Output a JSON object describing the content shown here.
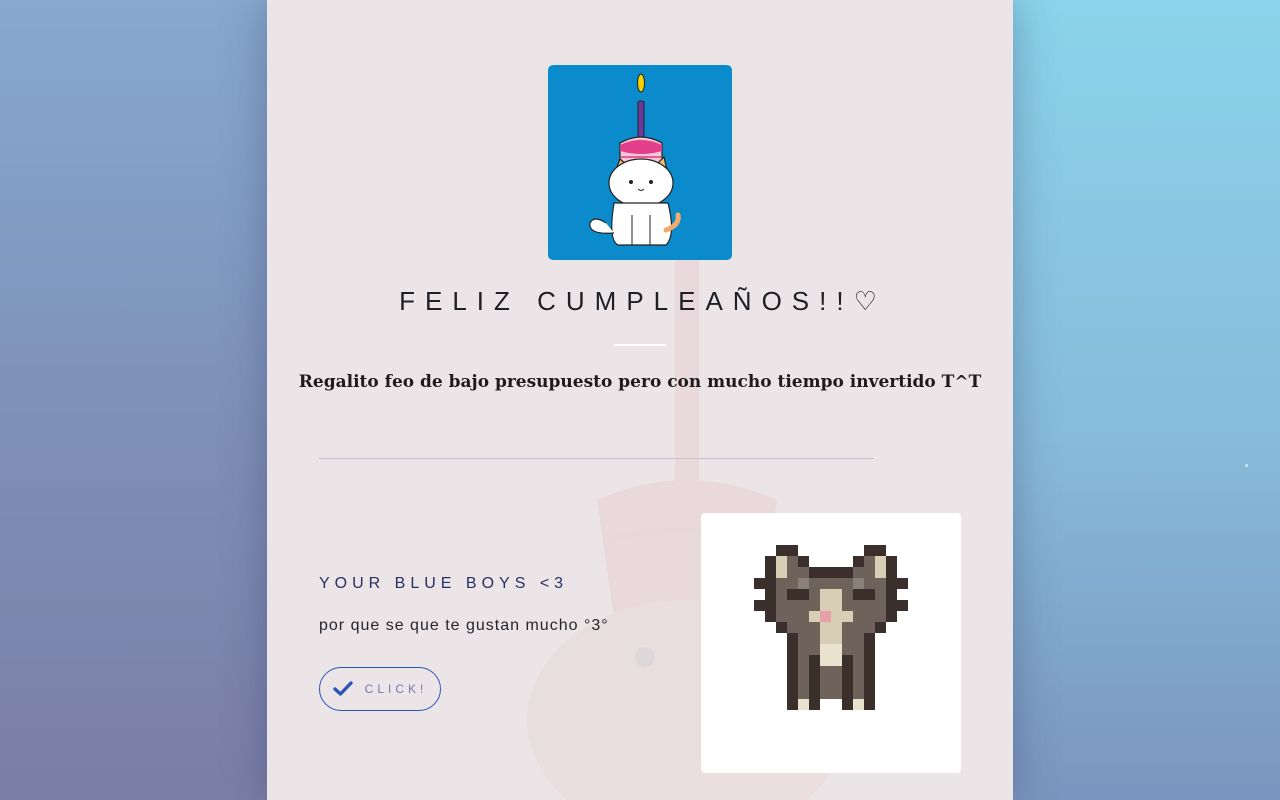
{
  "page": {
    "title": "FELIZ CUMPLEAÑOS!!♡",
    "subtitle": "Regalito feo de bajo presupuesto pero con mucho tiempo invertido T^T"
  },
  "avatar": {
    "image": "cat-with-birthday-cake-illustration",
    "background": "#0b8bcb"
  },
  "section": {
    "heading": "YOUR BLUE BOYS <3",
    "text": "por que se que te gustan mucho °3°",
    "button_label": "CLICK!",
    "button_icon": "check-icon",
    "image": "pixel-art-cat"
  },
  "colors": {
    "card_background": "#ebe5e8",
    "accent_blue": "#2d55b8",
    "heading_color": "#2b2f63"
  }
}
